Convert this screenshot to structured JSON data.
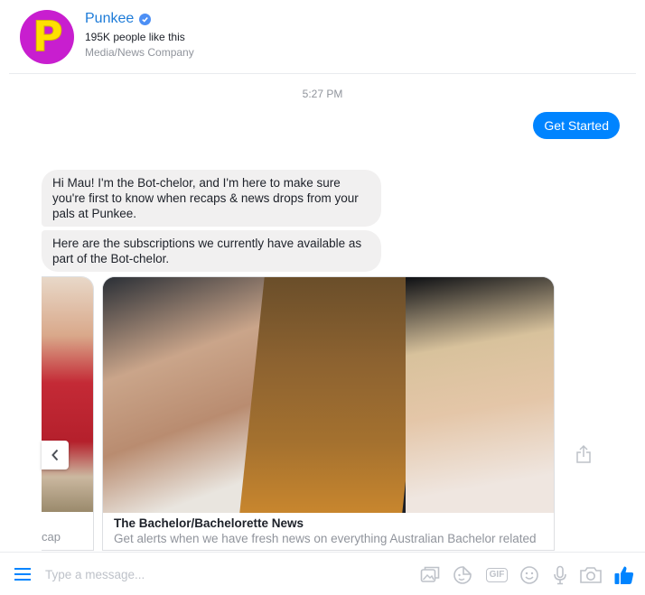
{
  "header": {
    "page_name": "Punkee",
    "avatar_letter": "P",
    "likes": "195K people like this",
    "category": "Media/News Company"
  },
  "thread": {
    "timestamp": "5:27 PM",
    "user_message": "Get Started",
    "bot_message_1": "Hi Mau! I'm the Bot-chelor, and I'm here to make sure you're first to know when recaps & news drops from your pals at Punkee.",
    "bot_message_2": "Here are the subscriptions we currently have available as part of the Bot-chelor."
  },
  "carousel": {
    "prev_card_caption": "cap",
    "card_title": "The Bachelor/Bachelorette News",
    "card_subtitle": "Get alerts when we have fresh news on everything Australian Bachelor related"
  },
  "composer": {
    "placeholder": "Type a message...",
    "gif_label": "GIF"
  },
  "colors": {
    "accent": "#0084ff",
    "bubble": "#f1f0f0",
    "brand_avatar": "#c81ecf"
  },
  "icons": [
    "verified-icon",
    "chevron-left-icon",
    "share-icon",
    "menu-icon",
    "image-icon",
    "sticker-icon",
    "gif-icon",
    "emoji-icon",
    "microphone-icon",
    "camera-icon",
    "thumbs-up-icon"
  ]
}
